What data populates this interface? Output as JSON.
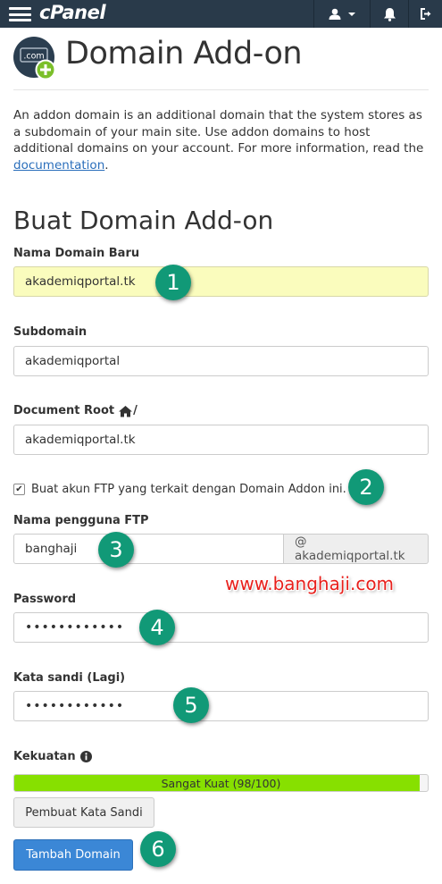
{
  "topbar": {
    "logo": "cPanel",
    "icons": [
      "menu-icon",
      "user-icon",
      "chevron-down-icon",
      "bell-icon",
      "logout-icon"
    ]
  },
  "header": {
    "icon_label": ".com",
    "title": "Domain Add-on"
  },
  "intro": {
    "text": "An addon domain is an additional domain that the system stores as a subdomain of your main site. Use addon domains to host additional domains on your account. For more information, read the ",
    "link": "documentation",
    "suffix": "."
  },
  "form": {
    "section_title": "Buat Domain Add-on",
    "new_domain": {
      "label": "Nama Domain Baru",
      "value": "akademiqportal.tk"
    },
    "subdomain": {
      "label": "Subdomain",
      "value": "akademiqportal"
    },
    "document_root": {
      "label": "Document Root",
      "suffix": "/",
      "value": "akademiqportal.tk"
    },
    "ftp_checkbox": {
      "label": "Buat akun FTP yang terkait dengan Domain Addon ini.",
      "checked": true,
      "mark": "✔"
    },
    "ftp_user": {
      "label": "Nama pengguna FTP",
      "value": "banghaji",
      "addon": "@ akademiqportal.tk"
    },
    "password": {
      "label": "Password",
      "value": "••••••••••••"
    },
    "password_again": {
      "label": "Kata sandi (Lagi)",
      "value": "••••••••••••"
    },
    "strength": {
      "label": "Kekuatan",
      "text": "Sangat Kuat (98/100)",
      "value": 98,
      "max": 100,
      "color": "#87e000"
    },
    "generate_button": "Pembuat Kata Sandi",
    "submit_button": "Tambah Domain"
  },
  "annotations": [
    "1",
    "2",
    "3",
    "4",
    "5",
    "6"
  ],
  "watermark": "www.banghaji.com",
  "colors": {
    "topbar": "#293a4a",
    "primary": "#3b87d6",
    "highlight": "#fafcbd",
    "badge": "#119977",
    "link": "#2a6ebb"
  }
}
